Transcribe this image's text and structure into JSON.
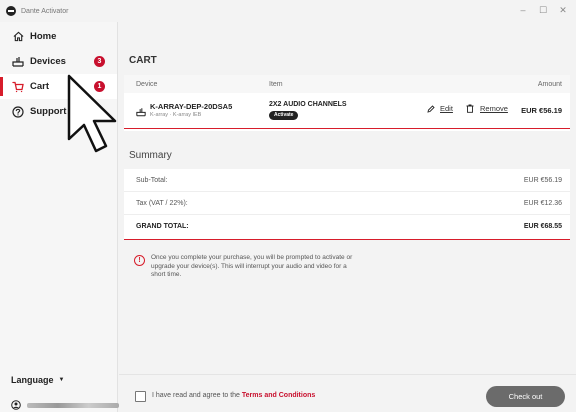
{
  "window": {
    "title": "Dante Activator",
    "controls": [
      "–",
      "☐",
      "✕"
    ]
  },
  "sidebar": {
    "items": [
      {
        "label": "Home",
        "icon": "home-icon"
      },
      {
        "label": "Devices",
        "icon": "device-icon",
        "badge": "3"
      },
      {
        "label": "Cart",
        "icon": "cart-icon",
        "badge": "1",
        "active": true
      },
      {
        "label": "Support",
        "icon": "support-icon"
      }
    ],
    "language_label": "Language",
    "language_caret": "▼"
  },
  "cart": {
    "heading": "CART",
    "columns": {
      "device": "Device",
      "item": "Item",
      "amount": "Amount"
    },
    "row": {
      "device_name": "K-ARRAY-DEP-20DSA5",
      "device_sub": "K-array · K-array IEB",
      "item_name": "2X2 AUDIO CHANNELS",
      "item_tag": "Activate",
      "edit_label": "Edit",
      "remove_label": "Remove",
      "amount": "EUR €56.19"
    }
  },
  "summary": {
    "heading": "Summary",
    "subtotal_label": "Sub-Total:",
    "subtotal_value": "EUR €56.19",
    "tax_label": "Tax (VAT / 22%):",
    "tax_value": "EUR €12.36",
    "total_label": "GRAND TOTAL:",
    "total_value": "EUR €68.55"
  },
  "notice": {
    "icon": "!",
    "text": "Once you complete your purchase, you will be prompted to activate or upgrade your device(s). This will interrupt your audio and video for a short time."
  },
  "footer": {
    "agree_prefix": "I have read and agree to the ",
    "terms_label": "Terms and Conditions",
    "checkout_label": "Check out"
  },
  "colors": {
    "accent": "#d71d2b",
    "badge": "#c8102e",
    "checkout_disabled": "#6b6b6b"
  }
}
